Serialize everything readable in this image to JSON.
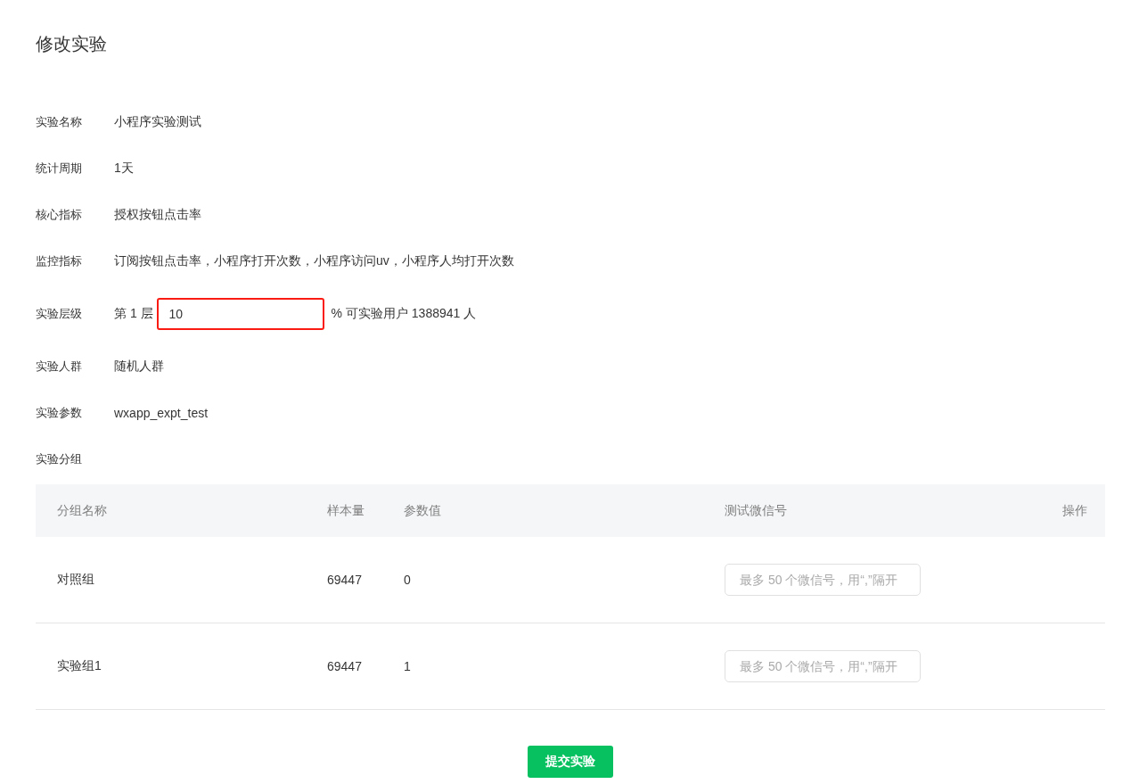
{
  "title": "修改实验",
  "fields": [
    {
      "label": "实验名称",
      "value": "小程序实验测试"
    },
    {
      "label": "统计周期",
      "value": "1天"
    },
    {
      "label": "核心指标",
      "value": "授权按钮点击率"
    },
    {
      "label": "监控指标",
      "value": "订阅按钮点击率，小程序打开次数，小程序访问uv，小程序人均打开次数"
    }
  ],
  "layer": {
    "label": "实验层级",
    "prefix": "第 1 层",
    "input_value": "10",
    "error": true,
    "suffix": "% 可实验用户 1388941 人"
  },
  "fields_after": [
    {
      "label": "实验人群",
      "value": "随机人群"
    },
    {
      "label": "实验参数",
      "value": "wxapp_expt_test"
    }
  ],
  "groups_label": "实验分组",
  "table": {
    "columns": [
      "分组名称",
      "样本量",
      "参数值",
      "测试微信号",
      "操作"
    ],
    "rows": [
      {
        "name": "对照组",
        "sample": "69447",
        "param": "0",
        "wechat_placeholder": "最多 50 个微信号，用“,”隔开"
      },
      {
        "name": "实验组1",
        "sample": "69447",
        "param": "1",
        "wechat_placeholder": "最多 50 个微信号，用“,”隔开"
      }
    ]
  },
  "submit_button": "提交实验"
}
